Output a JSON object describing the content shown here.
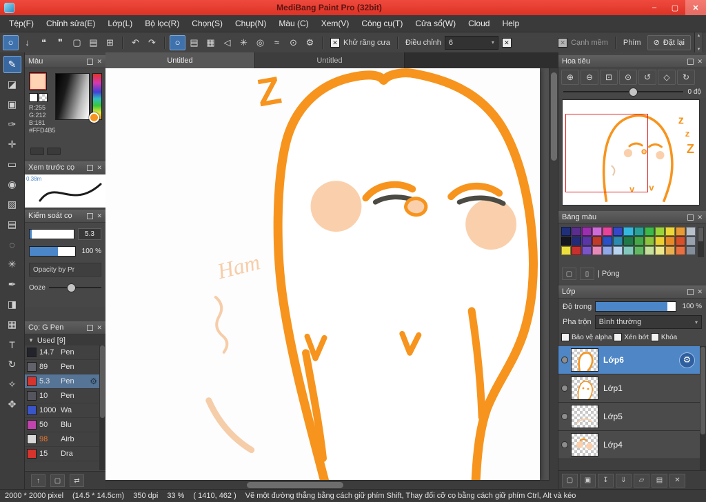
{
  "window": {
    "title": "MediBang Paint Pro (32bit)"
  },
  "window_icons": {
    "minimize": "–",
    "maximize": "▢",
    "close": "✕"
  },
  "icons": {
    "close": "✕",
    "check": "✕",
    "gear": "⚙",
    "dropdown": "▾",
    "used_arrow": "▼"
  },
  "menubar": {
    "items": [
      "Tệp(F)",
      "Chỉnh sửa(E)",
      "Lớp(L)",
      "Bộ lọc(R)",
      "Chọn(S)",
      "Chụp(N)",
      "Màu (C)",
      "Xem(V)",
      "Công cụ(T)",
      "Cửa sổ(W)",
      "Cloud",
      "Help"
    ]
  },
  "topbar": {
    "icons_a": [
      {
        "name": "select-ellipse",
        "glyph": "○"
      },
      {
        "name": "save",
        "glyph": "↓"
      },
      {
        "name": "comment",
        "glyph": "❝"
      },
      {
        "name": "chat",
        "glyph": "❞"
      },
      {
        "name": "new-document",
        "glyph": "▢"
      },
      {
        "name": "open-documents",
        "glyph": "▤"
      },
      {
        "name": "cell-grid",
        "glyph": "⊞"
      }
    ],
    "undo": "↶",
    "redo": "↷",
    "icons_b": [
      {
        "name": "snap-off",
        "glyph": "○"
      },
      {
        "name": "snap-parallel",
        "glyph": "▤"
      },
      {
        "name": "snap-cross",
        "glyph": "▦"
      },
      {
        "name": "snap-triangle",
        "glyph": "◁"
      },
      {
        "name": "snap-radial",
        "glyph": "✳"
      },
      {
        "name": "snap-circle",
        "glyph": "◎"
      },
      {
        "name": "snap-curve",
        "glyph": "≈"
      },
      {
        "name": "snap-ellipse",
        "glyph": "⊙"
      },
      {
        "name": "snap-settings",
        "glyph": "⚙"
      }
    ]
  },
  "toolbar": {
    "antialias": "Khử răng cưa",
    "adjust": "Điều chỉnh",
    "adjust_value": "6",
    "soft_edge": "Cạnh mềm",
    "key": "Phím",
    "reset": "Đặt lại",
    "reset_icon": "⊘"
  },
  "tools": [
    {
      "name": "brush",
      "glyph": "✎"
    },
    {
      "name": "eraser",
      "glyph": "◪"
    },
    {
      "name": "stamp",
      "glyph": "▣"
    },
    {
      "name": "pencil",
      "glyph": "✑"
    },
    {
      "name": "move",
      "glyph": "✛"
    },
    {
      "name": "select-rect",
      "glyph": "▭"
    },
    {
      "name": "bucket-fill",
      "glyph": "◉"
    },
    {
      "name": "gradient",
      "glyph": "▨"
    },
    {
      "name": "select-marquee",
      "glyph": "▤"
    },
    {
      "name": "lasso",
      "glyph": "◌"
    },
    {
      "name": "magic-wand",
      "glyph": "✳"
    },
    {
      "name": "select-pen",
      "glyph": "✒"
    },
    {
      "name": "select-eraser",
      "glyph": "◨"
    },
    {
      "name": "pattern",
      "glyph": "▦"
    },
    {
      "name": "text",
      "glyph": "T"
    },
    {
      "name": "rotate-canvas",
      "glyph": "↻"
    },
    {
      "name": "eyedropper",
      "glyph": "✧"
    },
    {
      "name": "hand",
      "glyph": "✥"
    }
  ],
  "tabs": {
    "tab1": "Untitled",
    "tab2": "Untitled"
  },
  "color_panel": {
    "title": "Màu",
    "r": "R:255",
    "g": "G:212",
    "b": "B:181",
    "hex": "#FFD4B5",
    "swatch": "#FFD4B5"
  },
  "brush_preview": {
    "title": "Xem trước cọ",
    "size": "0.38m"
  },
  "brush_control": {
    "title": "Kiểm soát cọ",
    "size_value": "5.3",
    "opacity_value": "100 %",
    "pressure_label": "Opacity by Pr",
    "ooze_label": "Ooze"
  },
  "brushes": {
    "title": "Cọ: G Pen",
    "used": "Used [9]",
    "items": [
      {
        "size": "14.7",
        "name": "Pen",
        "color": "#23232b"
      },
      {
        "size": "89",
        "name": "Pen",
        "color": "#62626a"
      },
      {
        "size": "5.3",
        "name": "Pen",
        "color": "#d8342e",
        "selected": true
      },
      {
        "size": "10",
        "name": "Pen",
        "color": "#55555d"
      },
      {
        "size": "1000",
        "name": "Wa",
        "color": "#3a55c8"
      },
      {
        "size": "50",
        "name": "Blu",
        "color": "#c043ae"
      },
      {
        "size": "98",
        "name": "Airb",
        "color": "#d8d8d8"
      },
      {
        "size": "15",
        "name": "Dra",
        "color": "#d8342e"
      }
    ]
  },
  "left_footer": [
    {
      "name": "upload-brush",
      "glyph": "↑"
    },
    {
      "name": "add-brush",
      "glyph": "▢"
    },
    {
      "name": "brush-menu",
      "glyph": "⇄"
    }
  ],
  "navigator": {
    "title": "Hoa tiêu",
    "angle": "0 độ",
    "icons": [
      {
        "name": "zoom-in",
        "glyph": "⊕"
      },
      {
        "name": "zoom-out",
        "glyph": "⊖"
      },
      {
        "name": "fit-window",
        "glyph": "⊡"
      },
      {
        "name": "zoom-reset",
        "glyph": "⊙"
      },
      {
        "name": "rotate-left",
        "glyph": "↺"
      },
      {
        "name": "reset-rotation",
        "glyph": "◇"
      },
      {
        "name": "rotate-right",
        "glyph": "↻"
      }
    ]
  },
  "palette": {
    "title": "Bảng màu",
    "action_label": "| Póng",
    "icons": [
      {
        "name": "add-color",
        "glyph": "▢"
      },
      {
        "name": "delete-color",
        "glyph": "▯"
      }
    ],
    "rows": [
      [
        "#1f2f7a",
        "#5b2d8e",
        "#9b2fae",
        "#cf6bd6",
        "#e8439a",
        "#3548c8",
        "#35b8e0",
        "#2aa198",
        "#3cb84a",
        "#9ad43a",
        "#ecd83a",
        "#e89a35",
        "#b8c0ca"
      ],
      [
        "#15151f",
        "#232a7a",
        "#5a35a8",
        "#c03a2a",
        "#2a50c8",
        "#2a8ab0",
        "#1f7a48",
        "#44a848",
        "#8cc43e",
        "#ecd030",
        "#e88a28",
        "#d8502a",
        "#98a2ae"
      ],
      [
        "#ecde3e",
        "#c83030",
        "#7a55c8",
        "#e88ab8",
        "#90a8e8",
        "#b8d4f0",
        "#82c8bc",
        "#62b862",
        "#c4e09a",
        "#ece88a",
        "#e8b050",
        "#e87040",
        "#848e9a"
      ]
    ]
  },
  "layers": {
    "title": "Lớp",
    "opacity_label": "Độ trong",
    "opacity_value": "100 %",
    "blend_label": "Pha trộn",
    "blend_value": "Bình thường",
    "check1": "Bảo vệ alpha",
    "check2": "Xén bớt",
    "check3": "Khóa",
    "items": [
      {
        "name": "Lớp6",
        "selected": true
      },
      {
        "name": "Lớp1"
      },
      {
        "name": "Lớp5"
      },
      {
        "name": "Lớp4"
      }
    ],
    "footer_icons": [
      {
        "name": "add-layer",
        "glyph": "▢"
      },
      {
        "name": "duplicate-layer",
        "glyph": "▣"
      },
      {
        "name": "transfer-layer",
        "glyph": "↧"
      },
      {
        "name": "merge-down",
        "glyph": "⇓"
      },
      {
        "name": "layer-folder",
        "glyph": "▱"
      },
      {
        "name": "copy-layer",
        "glyph": "▤"
      },
      {
        "name": "delete-layer",
        "glyph": "✕"
      }
    ]
  },
  "artwork": {
    "z_big": "Z",
    "z_small": "z",
    "v": "V",
    "v_small": "v",
    "signature": "Ham"
  },
  "statusbar": {
    "size": "2000 * 2000 pixel",
    "cm": "(14.5 * 14.5cm)",
    "dpi": "350 dpi",
    "zoom": "33 %",
    "coords": "( 1410, 462 )",
    "hint": "Vẽ một đường thẳng bằng cách giữ phím Shift, Thay đổi cỡ cọ bằng cách giữ phím Ctrl, Alt và kéo"
  },
  "colors": {
    "accent_orange": "#F7941D",
    "selection_blue": "#4f86c6",
    "title_red": "#e8433a"
  }
}
